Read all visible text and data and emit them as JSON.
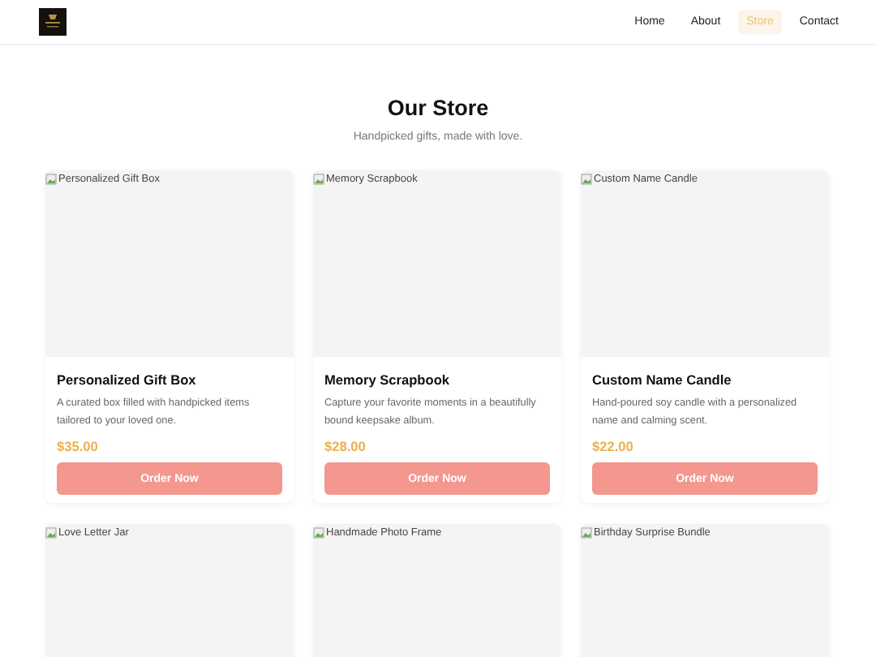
{
  "nav": {
    "links": [
      {
        "label": "Home",
        "selected": false
      },
      {
        "label": "About",
        "selected": false
      },
      {
        "label": "Store",
        "selected": true
      },
      {
        "label": "Contact",
        "selected": false
      }
    ]
  },
  "header": {
    "title": "Our Store",
    "subtitle": "Handpicked gifts, made with love."
  },
  "products": [
    {
      "image_alt": "Personalized Gift Box",
      "name": "Personalized Gift Box",
      "description": "A curated box filled with handpicked items tailored to your loved one.",
      "price": "$35.00",
      "button": "Order Now"
    },
    {
      "image_alt": "Memory Scrapbook",
      "name": "Memory Scrapbook",
      "description": "Capture your favorite moments in a beautifully bound keepsake album.",
      "price": "$28.00",
      "button": "Order Now"
    },
    {
      "image_alt": "Custom Name Candle",
      "name": "Custom Name Candle",
      "description": "Hand-poured soy candle with a personalized name and calming scent.",
      "price": "$22.00",
      "button": "Order Now"
    },
    {
      "image_alt": "Love Letter Jar"
    },
    {
      "image_alt": "Handmade Photo Frame"
    },
    {
      "image_alt": "Birthday Surprise Bundle"
    }
  ]
}
